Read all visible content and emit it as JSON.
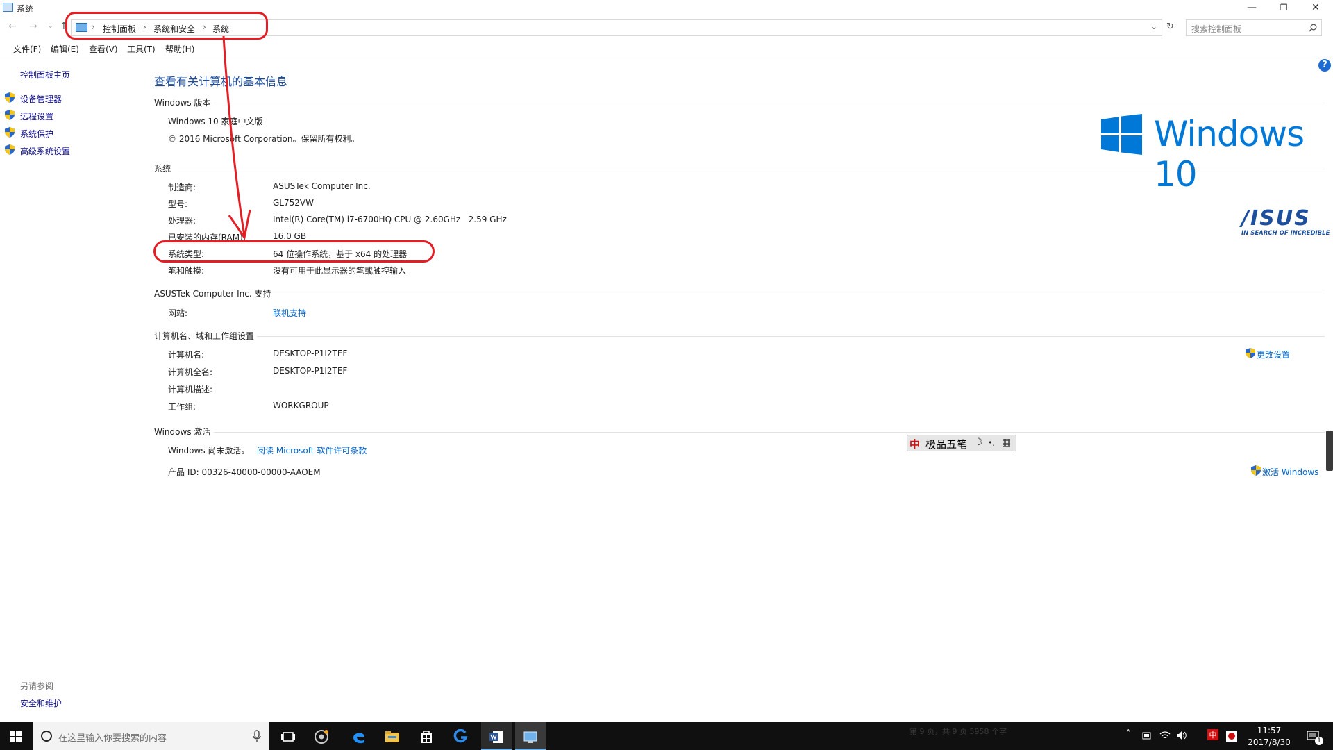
{
  "window": {
    "title": "系统",
    "minimize": "—",
    "restore": "❐",
    "close": "✕"
  },
  "nav": {
    "back": "←",
    "forward": "→",
    "recent": "⌄",
    "up": "↑",
    "breadcrumb": [
      "控制面板",
      "系统和安全",
      "系统"
    ],
    "dropdown": "⌄",
    "refresh": "↻"
  },
  "search": {
    "placeholder": "搜索控制面板",
    "icon": "search-icon"
  },
  "menubar": [
    "文件(F)",
    "编辑(E)",
    "查看(V)",
    "工具(T)",
    "帮助(H)"
  ],
  "sidebar": {
    "home": "控制面板主页",
    "items": [
      "设备管理器",
      "远程设置",
      "系统保护",
      "高级系统设置"
    ],
    "see_also_title": "另请参阅",
    "see_also": "安全和维护"
  },
  "main": {
    "heading": "查看有关计算机的基本信息",
    "edition": {
      "title": "Windows 版本",
      "name": "Windows 10 家庭中文版",
      "copyright": "© 2016 Microsoft Corporation。保留所有权利。"
    },
    "system": {
      "title": "系统",
      "rows": [
        {
          "label": "制造商:",
          "value": "ASUSTek Computer Inc."
        },
        {
          "label": "型号:",
          "value": "GL752VW"
        },
        {
          "label": "处理器:",
          "value": "Intel(R) Core(TM) i7-6700HQ CPU @ 2.60GHz   2.59 GHz"
        },
        {
          "label": "已安装的内存(RAM):",
          "value": "16.0 GB"
        },
        {
          "label": "系统类型:",
          "value": "64 位操作系统，基于 x64 的处理器"
        },
        {
          "label": "笔和触摸:",
          "value": "没有可用于此显示器的笔或触控输入"
        }
      ]
    },
    "support": {
      "title": "ASUSTek Computer Inc. 支持",
      "label": "网站:",
      "link": "联机支持"
    },
    "computer": {
      "title": "计算机名、域和工作组设置",
      "rows": [
        {
          "label": "计算机名:",
          "value": "DESKTOP-P1I2TEF"
        },
        {
          "label": "计算机全名:",
          "value": "DESKTOP-P1I2TEF"
        },
        {
          "label": "计算机描述:",
          "value": ""
        },
        {
          "label": "工作组:",
          "value": "WORKGROUP"
        }
      ],
      "change_link": "更改设置"
    },
    "activation": {
      "title": "Windows 激活",
      "status": "Windows 尚未激活。",
      "license_link": "阅读 Microsoft 软件许可条款",
      "product_id": "产品 ID: 00326-40000-00000-AAOEM",
      "activate_link": "激活 Windows"
    },
    "logo_text": "Windows 10",
    "asus_brand": "/ISUS",
    "asus_tagline": "IN SEARCH OF INCREDIBLE",
    "help": "?"
  },
  "ime": {
    "char": "中",
    "name": "极品五笔",
    "moon": "☽",
    "dots": "•,",
    "kbd": "▦"
  },
  "taskbar": {
    "search_placeholder": "在这里输入你要搜索的内容",
    "faded_text": "第 9 页，共 9 页   5958 个字",
    "tray_lang": "中",
    "time": "11:57",
    "date": "2017/8/30",
    "notif_count": "1"
  },
  "colors": {
    "accent": "#0078d7",
    "link": "#0066cc",
    "heading": "#1a4da1",
    "annotation": "#e31e24",
    "taskbar": "#101010"
  }
}
